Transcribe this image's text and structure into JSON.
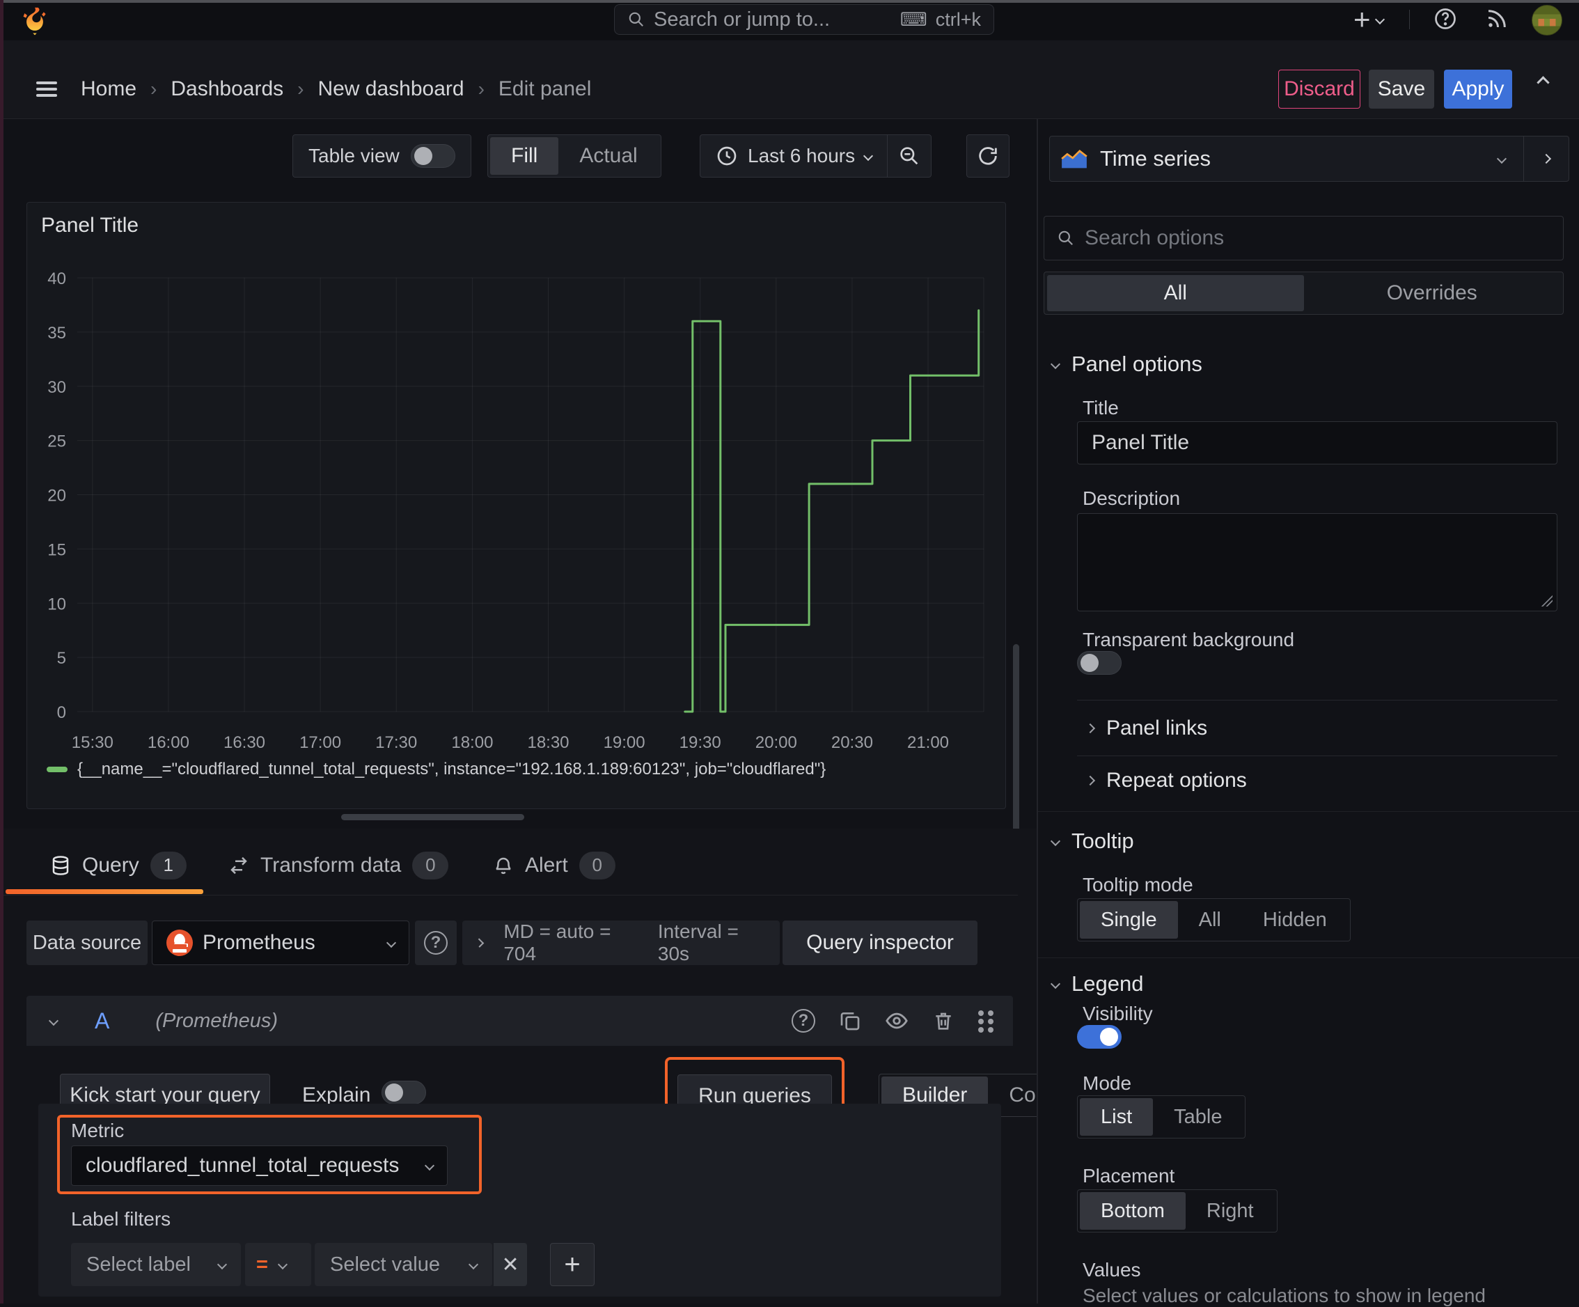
{
  "topbar": {
    "search_placeholder": "Search or jump to...",
    "search_shortcut": "ctrl+k"
  },
  "breadcrumb": {
    "items": [
      "Home",
      "Dashboards",
      "New dashboard"
    ],
    "current": "Edit panel"
  },
  "actions": {
    "discard": "Discard",
    "save": "Save",
    "apply": "Apply"
  },
  "toolbar": {
    "table_view": "Table view",
    "fill": "Fill",
    "actual": "Actual",
    "time_range": "Last 6 hours"
  },
  "viz_picker": {
    "label": "Time series"
  },
  "panel": {
    "title": "Panel Title"
  },
  "chart_data": {
    "type": "line",
    "title": "Panel Title",
    "x_domain": [
      "15:24",
      "21:22"
    ],
    "x_ticks": [
      "15:30",
      "16:00",
      "16:30",
      "17:00",
      "17:30",
      "18:00",
      "18:30",
      "19:00",
      "19:30",
      "20:00",
      "20:30",
      "21:00"
    ],
    "ylim": [
      0,
      40
    ],
    "y_ticks": [
      0,
      5,
      10,
      15,
      20,
      25,
      30,
      35,
      40
    ],
    "grid": true,
    "legend_position": "bottom",
    "series": [
      {
        "name": "{__name__=\"cloudflared_tunnel_total_requests\", instance=\"192.168.1.189:60123\", job=\"cloudflared\"}",
        "color": "#73bf69",
        "points": [
          [
            "19:24",
            0
          ],
          [
            "19:27",
            0
          ],
          [
            "19:27",
            36
          ],
          [
            "19:38",
            36
          ],
          [
            "19:38",
            0
          ],
          [
            "19:40",
            0
          ],
          [
            "19:40",
            8
          ],
          [
            "20:13",
            8
          ],
          [
            "20:13",
            21
          ],
          [
            "20:38",
            21
          ],
          [
            "20:38",
            25
          ],
          [
            "20:53",
            25
          ],
          [
            "20:53",
            31
          ],
          [
            "21:20",
            31
          ],
          [
            "21:20",
            37
          ]
        ]
      }
    ]
  },
  "tabs": {
    "query": "Query",
    "query_count": "1",
    "transform": "Transform data",
    "transform_count": "0",
    "alert": "Alert",
    "alert_count": "0"
  },
  "datasource": {
    "label": "Data source",
    "value": "Prometheus",
    "stats_md": "MD = auto = 704",
    "stats_interval": "Interval = 30s",
    "inspector": "Query inspector"
  },
  "query_editor": {
    "ref_id": "A",
    "ds_hint": "(Prometheus)",
    "kickstart": "Kick start your query",
    "explain": "Explain",
    "run_queries": "Run queries",
    "builder": "Builder",
    "code": "Code",
    "metric_label": "Metric",
    "metric_value": "cloudflared_tunnel_total_requests",
    "label_filters": "Label filters",
    "select_label": "Select label",
    "operator": "=",
    "select_value": "Select value",
    "remove": "✕",
    "add": "+"
  },
  "sidebar": {
    "search_placeholder": "Search options",
    "tabs": {
      "all": "All",
      "overrides": "Overrides"
    },
    "panel_options": {
      "title": "Panel options",
      "title_label": "Title",
      "title_value": "Panel Title",
      "description_label": "Description",
      "transparent_label": "Transparent background"
    },
    "panel_links": "Panel links",
    "repeat_options": "Repeat options",
    "tooltip": {
      "title": "Tooltip",
      "mode_label": "Tooltip mode",
      "options": [
        "Single",
        "All",
        "Hidden"
      ],
      "selected": "Single"
    },
    "legend": {
      "title": "Legend",
      "visibility_label": "Visibility",
      "mode_label": "Mode",
      "mode_options": [
        "List",
        "Table"
      ],
      "mode_selected": "List",
      "placement_label": "Placement",
      "placement_options": [
        "Bottom",
        "Right"
      ],
      "placement_selected": "Bottom",
      "values_label": "Values",
      "values_desc": "Select values or calculations to show in legend"
    }
  },
  "colors": {
    "series_green": "#73bf69",
    "accent_orange": "#f2632a",
    "primary_blue": "#3d71d9",
    "destructive_pink": "#e0457b",
    "prometheus_orange": "#e6522c"
  }
}
